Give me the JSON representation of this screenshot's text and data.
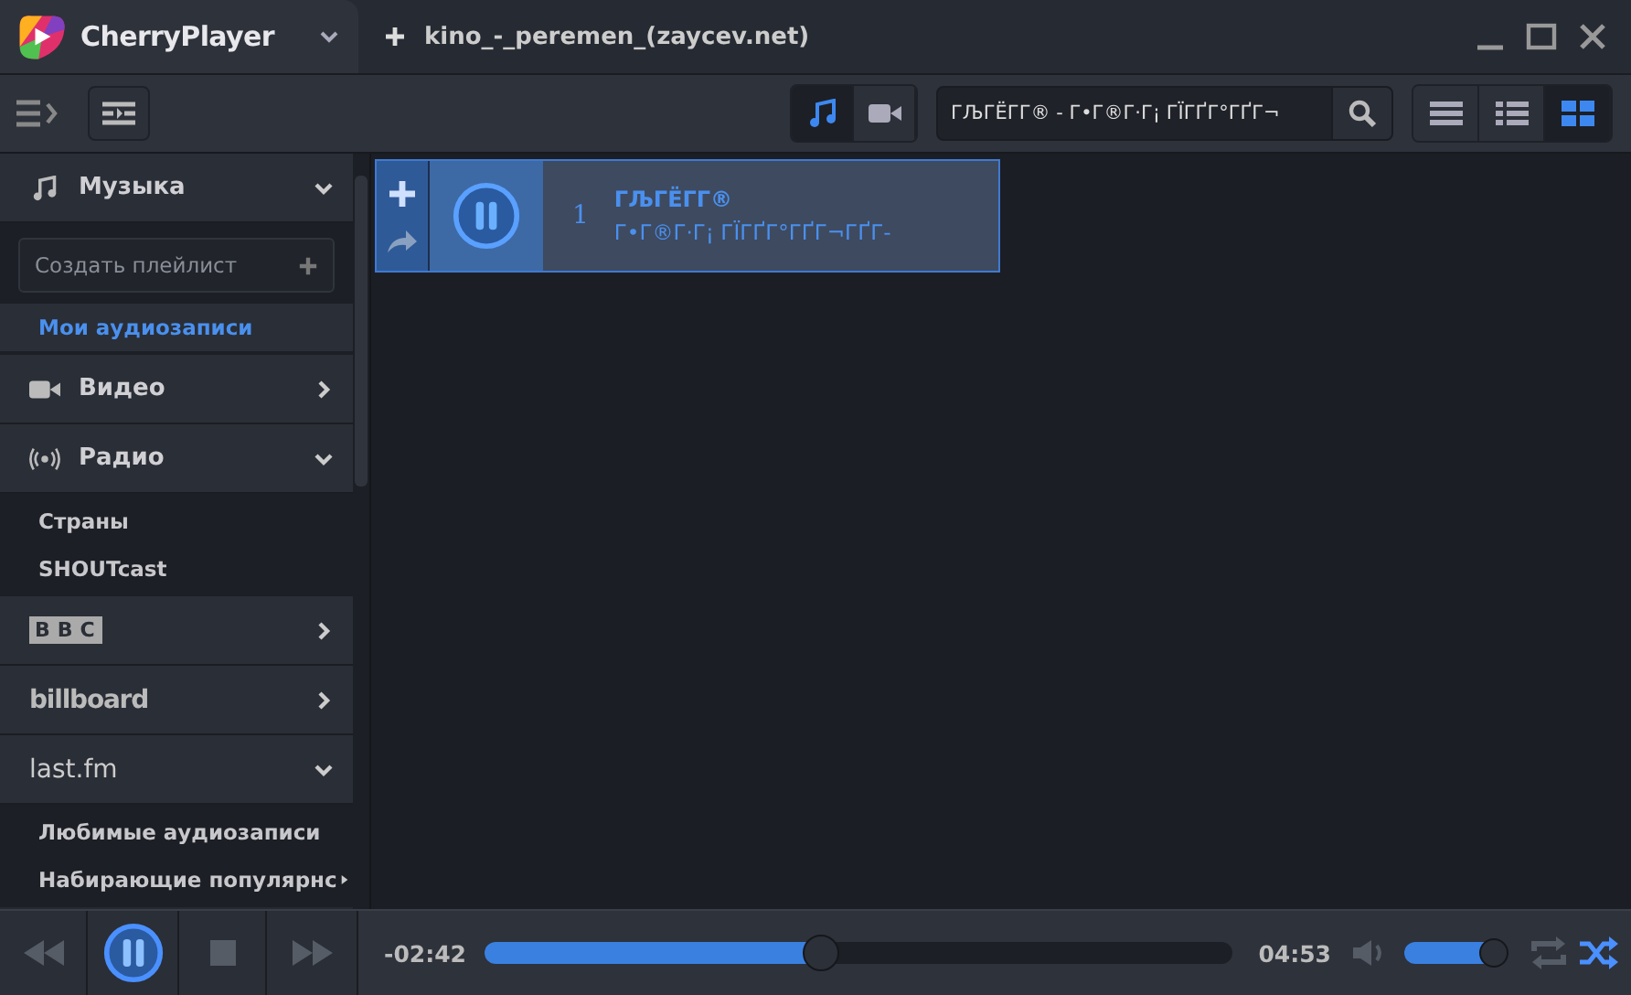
{
  "app": {
    "name": "CherryPlayer"
  },
  "tabs": [
    {
      "label": "kino_-_peremen_(zaycev.net)",
      "selected": false
    }
  ],
  "toolbar": {
    "media_types": [
      {
        "kind": "music",
        "selected": true
      },
      {
        "kind": "video",
        "selected": false
      }
    ],
    "search": {
      "value": "ГЉГЁГГ® - Г•Г®Г·Г¡ ГЇГҐГ°ГҐГ¬"
    },
    "views": [
      {
        "kind": "list",
        "selected": false
      },
      {
        "kind": "details",
        "selected": false
      },
      {
        "kind": "grid",
        "selected": true
      }
    ]
  },
  "sidebar": {
    "sections": [
      {
        "kind": "music",
        "label": "Музыка",
        "expanded": true,
        "playlist_field": {
          "placeholder": "Создать плейлист"
        },
        "children": [
          {
            "label": "Мои аудиозаписи",
            "selected": true
          }
        ]
      },
      {
        "kind": "video",
        "label": "Видео",
        "expanded": false
      },
      {
        "kind": "radio",
        "label": "Радио",
        "expanded": true,
        "children": [
          {
            "label": "Страны",
            "selected": false
          },
          {
            "label": "SHOUTcast",
            "selected": false
          }
        ]
      },
      {
        "kind": "bbc",
        "label": "BBC",
        "expanded": false
      },
      {
        "kind": "billboard",
        "label": "billboard",
        "expanded": false
      },
      {
        "kind": "lastfm",
        "label": "last.fm",
        "expanded": true,
        "children": [
          {
            "label": "Любимые аудиозаписи",
            "selected": false
          },
          {
            "label": "Набирающие популярнс",
            "selected": false,
            "submenu": true
          }
        ]
      }
    ]
  },
  "tracks": [
    {
      "number": "1",
      "title": "ГЉГЁГГ®",
      "artist": "Г•Г®Г·Г¡ ГЇГҐГ°ГҐГ¬ГҐГ­-",
      "playing": true
    }
  ],
  "player": {
    "elapsed": "-02:42",
    "duration": "04:53",
    "progress": {
      "level": 0.45
    },
    "volume": {
      "level": 0.88
    },
    "repeat": false,
    "shuffle": true,
    "paused": false
  }
}
